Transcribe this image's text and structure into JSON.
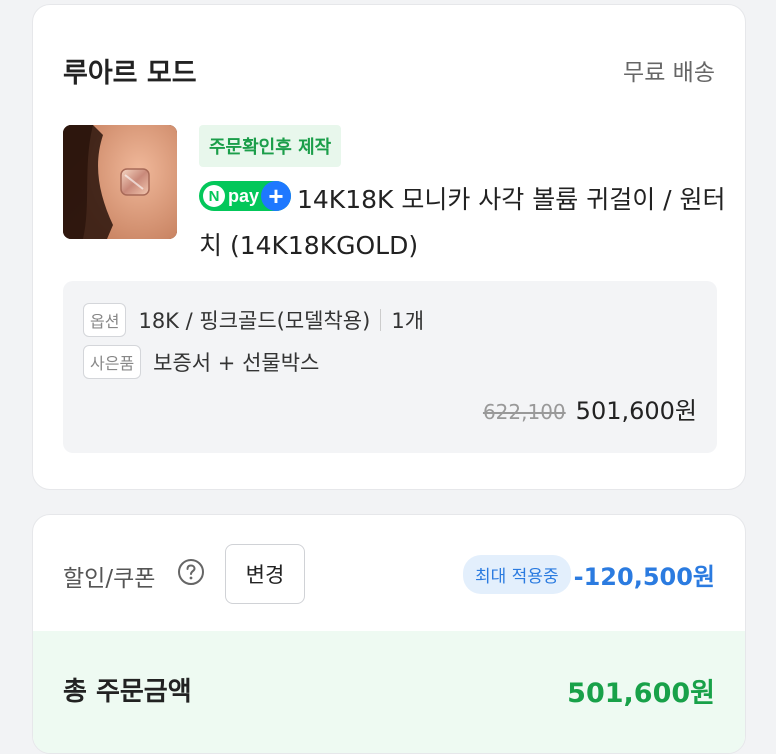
{
  "store": {
    "name": "루아르 모드",
    "shipping": "무료 배송"
  },
  "product": {
    "made_to_order_badge": "주문확인후 제작",
    "npay_badge": {
      "n": "N",
      "pay": "pay",
      "plus": "+"
    },
    "title": "14K18K 모니카 사각 볼륨 귀걸이 / 원터치 (14K18KGOLD)",
    "thumbnail_icon": "earring-product-photo"
  },
  "options": {
    "option_tag": "옵션",
    "option_value": "18K / 핑크골드(모델착용)",
    "quantity": "1개",
    "gift_tag": "사은품",
    "gift_value": "보증서 + 선물박스",
    "original_price": "622,100",
    "sale_price": "501,600원"
  },
  "payment": {
    "coupon_label": "할인/쿠폰",
    "help_icon": "question-circle-icon",
    "change_button": "변경",
    "max_badge": "최대 적용중",
    "discount": "-120,500원",
    "total_label": "총 주문금액",
    "total_value": "501,600원"
  },
  "colors": {
    "accent_green": "#18a149",
    "npay_green": "#03c75a",
    "accent_blue": "#2b7be0"
  }
}
